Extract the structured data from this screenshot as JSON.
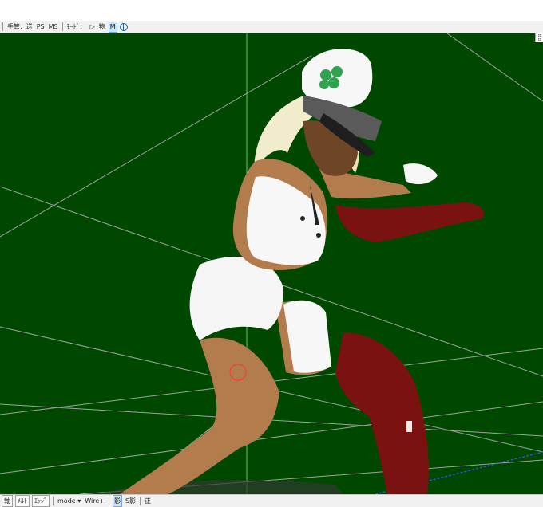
{
  "toolbar": {
    "label_prefix": "手管:",
    "btn_send": "送",
    "btn_ps": "PS",
    "btn_ms": "MS",
    "mode_label": "ﾓｰﾄﾞ：",
    "btn_play": "▷",
    "btn_physics": "物",
    "btn_m": "M"
  },
  "statusbar": {
    "btn_a": "軸",
    "btn_b": "ﾒﾙﾄ",
    "btn_edge": "ｴｯｼﾞ",
    "mode_select": "mode",
    "wire": "Wire+",
    "btn_shadow": "影",
    "btn_sshadow": "S影",
    "btn_right": "正"
  },
  "viewport": {
    "background": "#004800",
    "grid_color": "#9aa59a"
  }
}
